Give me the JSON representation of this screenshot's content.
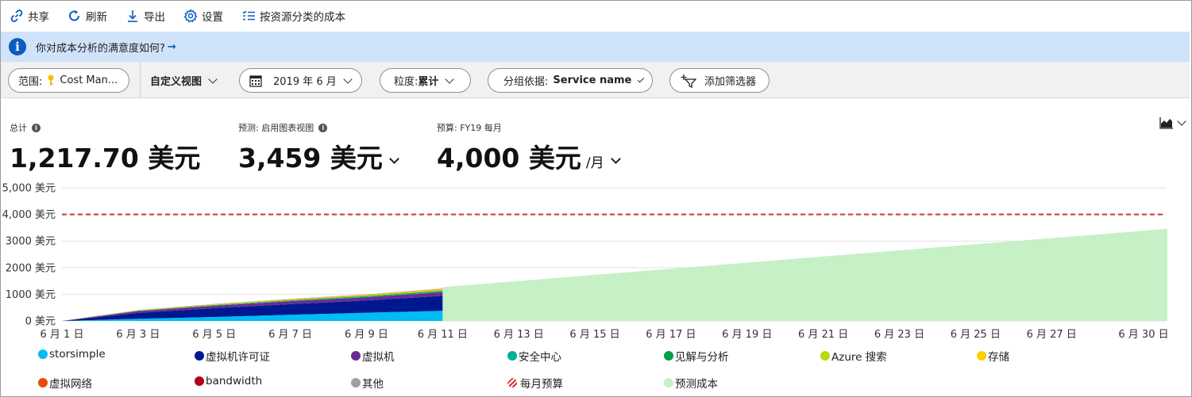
{
  "toolbar": {
    "share": "共享",
    "refresh": "刷新",
    "export": "导出",
    "settings": "设置",
    "cost_by_resource": "按资源分类的成本"
  },
  "infobar": {
    "text": "你对成本分析的满意度如何?"
  },
  "filters": {
    "scope_label": "范围:",
    "scope_value": "Cost Man...",
    "view": "自定义视图",
    "date": "2019 年 6 月",
    "granularity_label": "粒度:",
    "granularity_value": "累计",
    "groupby_label": "分组依据:",
    "groupby_value": "Service name",
    "add_filter": "添加筛选器"
  },
  "metrics": {
    "total_label": "总计",
    "total_value": "1,217.70 美元",
    "forecast_label": "预测: 启用图表视图",
    "forecast_value": "3,459 美元",
    "budget_label": "预算: FY19 每月",
    "budget_value": "4,000 美元",
    "budget_period": "/月"
  },
  "chart_data": {
    "type": "area",
    "stacked": true,
    "y_ticks": [
      "0 美元",
      "1000 美元",
      "2000 美元",
      "3000 美元",
      "4,000 美元",
      "5,000 美元"
    ],
    "ylim": [
      0,
      5000
    ],
    "x_ticks": [
      "6 月 1 日",
      "6 月 3 日",
      "6 月 5 日",
      "6 月 7 日",
      "6 月 9 日",
      "6 月 11 日",
      "6 月 13 日",
      "6 月 15 日",
      "6 月 17 日",
      "6 月 19 日",
      "6 月 21 日",
      "6 月 23 日",
      "6 月 25 日",
      "6 月 27 日",
      "6 月 30 日"
    ],
    "x_tick_days": [
      1,
      3,
      5,
      7,
      9,
      11,
      13,
      15,
      17,
      19,
      21,
      23,
      25,
      27,
      30
    ],
    "x_days": [
      1,
      3,
      5,
      7,
      9,
      11
    ],
    "series": [
      {
        "name": "storsimple",
        "color": "#00bcf2",
        "values": [
          0,
          80,
          150,
          230,
          310,
          380
        ]
      },
      {
        "name": "虚拟机许可证",
        "color": "#00188f",
        "values": [
          0,
          220,
          330,
          400,
          460,
          560
        ]
      },
      {
        "name": "虚拟机",
        "color": "#6b2c91",
        "values": [
          0,
          70,
          90,
          110,
          120,
          140
        ]
      },
      {
        "name": "安全中心",
        "color": "#00b294",
        "values": [
          0,
          8,
          12,
          15,
          18,
          20
        ]
      },
      {
        "name": "见解与分析",
        "color": "#009e49",
        "values": [
          0,
          10,
          15,
          20,
          25,
          30
        ]
      },
      {
        "name": "Azure 搜索",
        "color": "#bad80a",
        "values": [
          0,
          12,
          18,
          25,
          30,
          40
        ]
      },
      {
        "name": "存储",
        "color": "#ffb900",
        "values": [
          0,
          8,
          12,
          15,
          20,
          28
        ]
      },
      {
        "name": "虚拟网络",
        "color": "#e74c0e",
        "values": [
          0,
          2,
          3,
          4,
          5,
          6
        ]
      },
      {
        "name": "bandwidth",
        "color": "#b4001e",
        "values": [
          0,
          1,
          2,
          2,
          3,
          4
        ]
      },
      {
        "name": "其他",
        "color": "#a0a0a0",
        "values": [
          0,
          2,
          3,
          4,
          5,
          6
        ]
      }
    ],
    "budget": {
      "name": "每月预算",
      "color": "#d13438",
      "value": 4000
    },
    "forecast": {
      "name": "预测成本",
      "color": "#c6f0c6",
      "x_days": [
        11,
        30
      ],
      "values": [
        1270,
        3459
      ]
    }
  },
  "legend": {
    "items": [
      {
        "label": "storsimple",
        "color": "#00bcf2"
      },
      {
        "label": "虚拟机许可证",
        "color": "#00188f"
      },
      {
        "label": "虚拟机",
        "color": "#6b2c91"
      },
      {
        "label": "安全中心",
        "color": "#00b294"
      },
      {
        "label": "见解与分析",
        "color": "#009e49"
      },
      {
        "label": "Azure 搜索",
        "color": "#bad80a"
      },
      {
        "label": "存储",
        "color": "#ffcd00"
      },
      {
        "label": "虚拟网络",
        "color": "#e74c0e"
      },
      {
        "label": "bandwidth",
        "color": "#b4001e"
      },
      {
        "label": "其他",
        "color": "#a0a0a0"
      },
      {
        "label": "每月预算",
        "color": "#d13438"
      },
      {
        "label": "预测成本",
        "color": "#c6f0c6"
      }
    ]
  }
}
